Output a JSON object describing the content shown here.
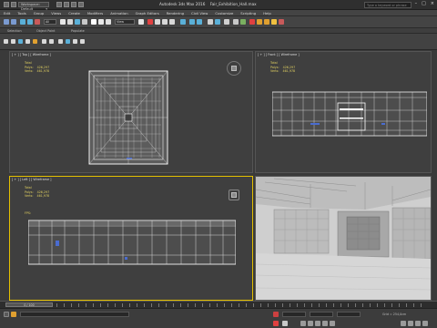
{
  "titlebar": {
    "workspace": "Workspace: Default",
    "app_title": "Autodesk 3ds Max 2016",
    "file_name": "Fair_Exhibition_Hall.max",
    "search_placeholder": "Type a keyword or phrase"
  },
  "menu": [
    "Edit",
    "Tools",
    "Group",
    "Views",
    "Create",
    "Modifiers",
    "Animation",
    "Graph Editors",
    "Rendering",
    "Civil View",
    "Customize",
    "Scripting",
    "Help"
  ],
  "toolbar": {
    "selection_filter": "All",
    "view_dropdown": "View"
  },
  "ribbon": {
    "tabs": [
      "Selection",
      "Object Paint",
      "Populate"
    ]
  },
  "viewports": {
    "top": {
      "label": "[ + ] [ Top ] [ Wireframe ]",
      "stat_title": "Total",
      "polys_label": "Polys:",
      "polys": "426,297",
      "verts_label": "Verts:",
      "verts": "461,978"
    },
    "front": {
      "label": "[ + ] [ Front ] [ Wireframe ]",
      "stat_title": "Total",
      "polys_label": "Polys:",
      "polys": "426,297",
      "verts_label": "Verts:",
      "verts": "461,978"
    },
    "left": {
      "label": "[ + ] [ Left ] [ Wireframe ]",
      "stat_title": "Total",
      "polys_label": "Polys:",
      "polys": "426,297",
      "verts_label": "Verts:",
      "verts": "461,978",
      "fps": "FPS:"
    },
    "perspective": {
      "label": ""
    }
  },
  "timeline": {
    "frame": "0 / 100"
  },
  "status": {
    "grid": "Grid = 254,0cm"
  },
  "colors": {
    "accent": "#e4c000",
    "viewport_bg": "#3f3f3f",
    "wire": "#e8e8e8"
  }
}
